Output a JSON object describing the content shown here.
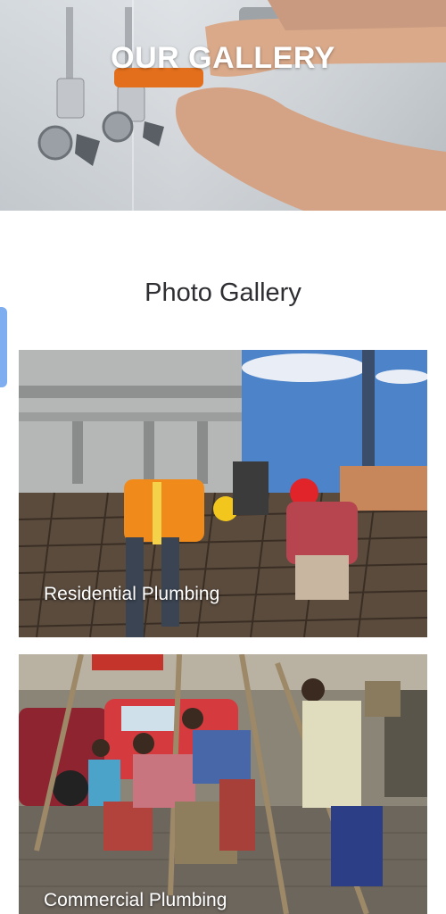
{
  "hero": {
    "title": "OUR GALLERY"
  },
  "gallery": {
    "heading": "Photo Gallery",
    "items": [
      {
        "caption": "Residential Plumbing"
      },
      {
        "caption": "Commercial Plumbing"
      }
    ]
  }
}
